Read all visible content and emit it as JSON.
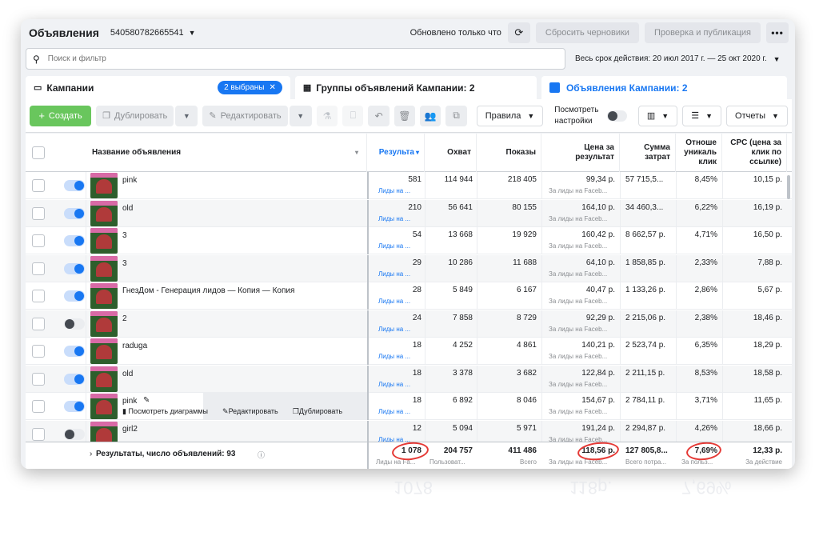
{
  "topbar": {
    "title": "Объявления",
    "account_id": "540580782665541",
    "updated": "Обновлено только что",
    "discard_label": "Сбросить черновики",
    "review_label": "Проверка и публикация",
    "more_label": "•••"
  },
  "search": {
    "placeholder": "Поиск и фильтр",
    "date_range": "Весь срок действия: 20 июл 2017 г. — 25 окт 2020 г."
  },
  "tabs": {
    "campaigns": "Кампании",
    "selected_badge": "2 выбраны",
    "adsets": "Группы объявлений Кампании: 2",
    "ads": "Объявления Кампании: 2"
  },
  "toolbar": {
    "create": "Создать",
    "duplicate": "Дублировать",
    "edit": "Редактировать",
    "rules": "Правила",
    "view_settings": "Посмотреть настройки",
    "reports": "Отчеты"
  },
  "columns": {
    "name": "Название объявления",
    "results": "Результа",
    "reach": "Охват",
    "impressions": "Показы",
    "cost_per_result": "Цена за результат",
    "amount_spent": "Сумма затрат",
    "unique_ctr": "Отноше уникаль клик",
    "cpc": "CPC (цена за клик по ссылке)"
  },
  "rows": [
    {
      "name": "pink",
      "on": true,
      "results": "581",
      "results_sub": "Лиды на ...",
      "reach": "114 944",
      "impressions": "218 405",
      "cpr": "99,34 р.",
      "cpr_sub": "За лиды на Faceb...",
      "spent": "57 715,5...",
      "ctr": "8,45%",
      "cpc": "10,15 р."
    },
    {
      "name": "old",
      "on": true,
      "results": "210",
      "results_sub": "Лиды на ...",
      "reach": "56 641",
      "impressions": "80 155",
      "cpr": "164,10 р.",
      "cpr_sub": "За лиды на Faceb...",
      "spent": "34 460,3...",
      "ctr": "6,22%",
      "cpc": "16,19 р."
    },
    {
      "name": "3",
      "on": true,
      "results": "54",
      "results_sub": "Лиды на ...",
      "reach": "13 668",
      "impressions": "19 929",
      "cpr": "160,42 р.",
      "cpr_sub": "За лиды на Faceb...",
      "spent": "8 662,57 р.",
      "ctr": "4,71%",
      "cpc": "16,50 р."
    },
    {
      "name": "3",
      "on": true,
      "results": "29",
      "results_sub": "Лиды на ...",
      "reach": "10 286",
      "impressions": "11 688",
      "cpr": "64,10 р.",
      "cpr_sub": "За лиды на Faceb...",
      "spent": "1 858,85 р.",
      "ctr": "2,33%",
      "cpc": "7,88 р."
    },
    {
      "name": "ГнезДом - Генерация лидов — Копия — Копия",
      "on": true,
      "results": "28",
      "results_sub": "Лиды на ...",
      "reach": "5 849",
      "impressions": "6 167",
      "cpr": "40,47 р.",
      "cpr_sub": "За лиды на Faceb...",
      "spent": "1 133,26 р.",
      "ctr": "2,86%",
      "cpc": "5,67 р."
    },
    {
      "name": "2",
      "on": false,
      "results": "24",
      "results_sub": "Лиды на ...",
      "reach": "7 858",
      "impressions": "8 729",
      "cpr": "92,29 р.",
      "cpr_sub": "За лиды на Faceb...",
      "spent": "2 215,06 р.",
      "ctr": "2,38%",
      "cpc": "18,46 р."
    },
    {
      "name": "raduga",
      "on": true,
      "results": "18",
      "results_sub": "Лиды на ...",
      "reach": "4 252",
      "impressions": "4 861",
      "cpr": "140,21 р.",
      "cpr_sub": "За лиды на Faceb...",
      "spent": "2 523,74 р.",
      "ctr": "6,35%",
      "cpc": "18,29 р."
    },
    {
      "name": "old",
      "on": true,
      "results": "18",
      "results_sub": "Лиды на ...",
      "reach": "3 378",
      "impressions": "3 682",
      "cpr": "122,84 р.",
      "cpr_sub": "За лиды на Faceb...",
      "spent": "2 211,15 р.",
      "ctr": "8,53%",
      "cpc": "18,58 р."
    },
    {
      "name": "pink",
      "on": true,
      "results": "18",
      "results_sub": "Лиды на ...",
      "reach": "6 892",
      "impressions": "8 046",
      "cpr": "154,67 р.",
      "cpr_sub": "За лиды на Faceb...",
      "spent": "2 784,11 р.",
      "ctr": "3,71%",
      "cpc": "11,65 р."
    },
    {
      "name": "girl2",
      "on": false,
      "results": "12",
      "results_sub": "Лиды на ...",
      "reach": "5 094",
      "impressions": "5 971",
      "cpr": "191,24 р.",
      "cpr_sub": "За лиды на Faceb...",
      "spent": "2 294,87 р.",
      "ctr": "4,26%",
      "cpc": "18,66 р."
    }
  ],
  "hover_actions": {
    "charts": "Посмотреть диаграммы",
    "edit": "Редактировать",
    "duplicate": "Дублировать"
  },
  "totals": {
    "label": "Результаты, число объявлений: 93",
    "results": "1 078",
    "results_sub": "Лиды на Fa...",
    "reach": "204 757",
    "reach_sub": "Пользоват...",
    "impressions": "411 486",
    "impressions_sub": "Всего",
    "cpr": "118,56 р.",
    "cpr_sub": "За лиды на Faceb...",
    "spent": "127 805,8...",
    "spent_sub": "Всего потра...",
    "ctr": "7,69%",
    "ctr_sub": "За польз...",
    "cpc": "12,33 р.",
    "cpc_sub": "За действие"
  },
  "reflection": {
    "results": "1078",
    "cpr": "118р.",
    "ctr": "7,69%"
  },
  "colors": {
    "accent": "#1877f2",
    "create_green": "#69c65d",
    "highlight_red": "#e53935"
  }
}
